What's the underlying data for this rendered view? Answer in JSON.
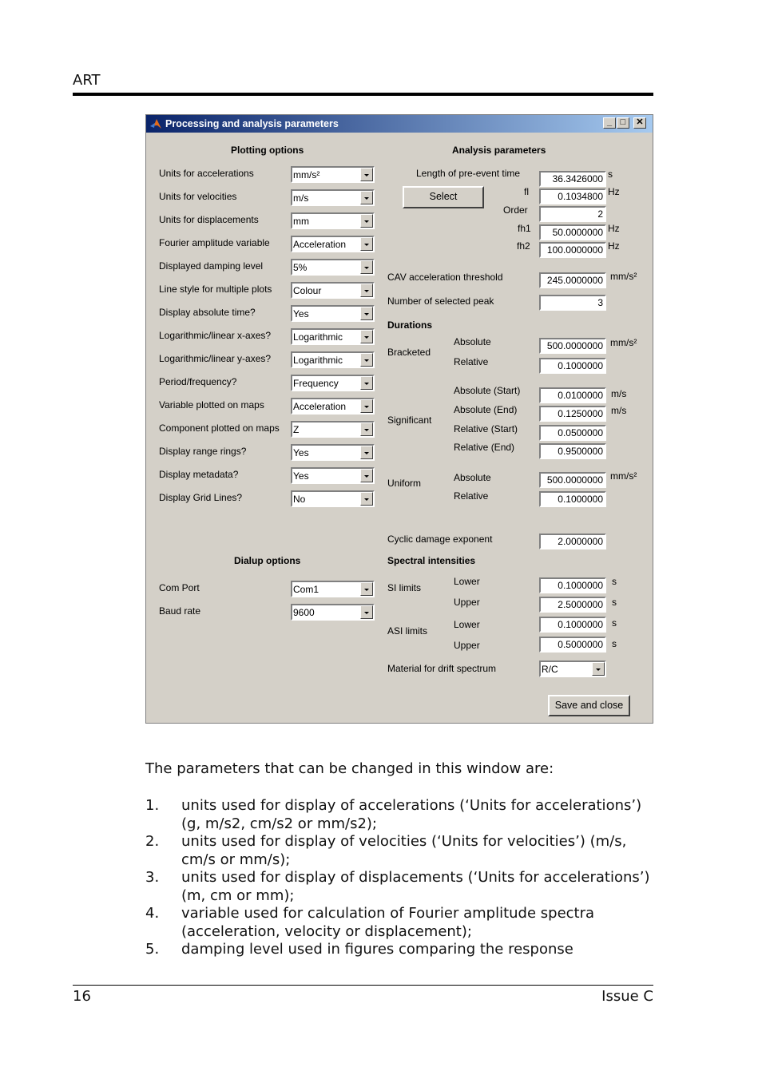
{
  "page": {
    "header": "ART",
    "footer_left": "16",
    "footer_right": "Issue C"
  },
  "window": {
    "title": "Processing and analysis parameters",
    "controls": {
      "minimize": "_",
      "maximize": "□",
      "close": "✕"
    },
    "plotting": {
      "heading": "Plotting options",
      "rows": [
        {
          "label": "Units for accelerations",
          "value": "mm/s²"
        },
        {
          "label": "Units for velocities",
          "value": "m/s"
        },
        {
          "label": "Units for displacements",
          "value": "mm"
        },
        {
          "label": "Fourier amplitude variable",
          "value": "Acceleration"
        },
        {
          "label": "Displayed damping level",
          "value": "5%"
        },
        {
          "label": "Line style for multiple plots",
          "value": "Colour"
        },
        {
          "label": "Display absolute time?",
          "value": "Yes"
        },
        {
          "label": "Logarithmic/linear x-axes?",
          "value": "Logarithmic"
        },
        {
          "label": "Logarithmic/linear y-axes?",
          "value": "Logarithmic"
        },
        {
          "label": "Period/frequency?",
          "value": "Frequency"
        },
        {
          "label": "Variable plotted on maps",
          "value": "Acceleration"
        },
        {
          "label": "Component plotted on maps",
          "value": "Z"
        },
        {
          "label": "Display range rings?",
          "value": "Yes"
        },
        {
          "label": "Display metadata?",
          "value": "Yes"
        },
        {
          "label": "Display Grid Lines?",
          "value": "No"
        }
      ]
    },
    "dialup": {
      "heading": "Dialup options",
      "rows": [
        {
          "label": "Com Port",
          "value": "Com1"
        },
        {
          "label": "Baud rate",
          "value": "9600"
        }
      ]
    },
    "analysis": {
      "heading": "Analysis parameters",
      "pre_event_label": "Length of pre-event time",
      "pre_event_value": "36.3426000",
      "pre_event_unit": "s",
      "select_button": "Select",
      "fl_label": "fl",
      "fl_value": "0.1034800",
      "fl_unit": "Hz",
      "order_label": "Order",
      "order_value": "2",
      "fh1_label": "fh1",
      "fh1_value": "50.0000000",
      "fh1_unit": "Hz",
      "fh2_label": "fh2",
      "fh2_value": "100.0000000",
      "fh2_unit": "Hz",
      "cav_label": "CAV acceleration threshold",
      "cav_value": "245.0000000",
      "cav_unit": "mm/s²",
      "peak_label": "Number of selected peak",
      "peak_value": "3",
      "durations_heading": "Durations",
      "bracketed": {
        "label": "Bracketed",
        "abs_label": "Absolute",
        "abs_value": "500.0000000",
        "abs_unit": "mm/s²",
        "rel_label": "Relative",
        "rel_value": "0.1000000"
      },
      "significant": {
        "label": "Significant",
        "abs_start_label": "Absolute (Start)",
        "abs_start_value": "0.0100000",
        "abs_start_unit": "m/s",
        "abs_end_label": "Absolute (End)",
        "abs_end_value": "0.1250000",
        "abs_end_unit": "m/s",
        "rel_start_label": "Relative (Start)",
        "rel_start_value": "0.0500000",
        "rel_end_label": "Relative (End)",
        "rel_end_value": "0.9500000"
      },
      "uniform": {
        "label": "Uniform",
        "abs_label": "Absolute",
        "abs_value": "500.0000000",
        "abs_unit": "mm/s²",
        "rel_label": "Relative",
        "rel_value": "0.1000000"
      },
      "cyclic_label": "Cyclic damage exponent",
      "cyclic_value": "2.0000000",
      "spectral_heading": "Spectral intensities",
      "si": {
        "label": "SI limits",
        "lower_label": "Lower",
        "lower_value": "0.1000000",
        "upper_label": "Upper",
        "upper_value": "2.5000000",
        "unit": "s"
      },
      "asi": {
        "label": "ASI limits",
        "lower_label": "Lower",
        "lower_value": "0.1000000",
        "upper_label": "Upper",
        "upper_value": "0.5000000",
        "unit": "s"
      },
      "material_label": "Material for drift spectrum",
      "material_value": "R/C",
      "save_button": "Save and close"
    }
  },
  "body": {
    "intro": "The parameters that can be changed in this window are:",
    "items": [
      {
        "num": "1.",
        "text": "units used for display of accelerations (‘Units for accelerations’) (g, m/s2, cm/s2 or mm/s2);"
      },
      {
        "num": "2.",
        "text": "units used for display of velocities (‘Units for velocities’) (m/s, cm/s or mm/s);"
      },
      {
        "num": "3.",
        "text": "units used for display of displacements (‘Units for accelerations’) (m, cm or mm);"
      },
      {
        "num": "4.",
        "text": "variable used for calculation of Fourier amplitude spectra (acceleration, velocity or displacement);"
      },
      {
        "num": "5.",
        "text": "damping level used in figures comparing the response"
      }
    ]
  }
}
